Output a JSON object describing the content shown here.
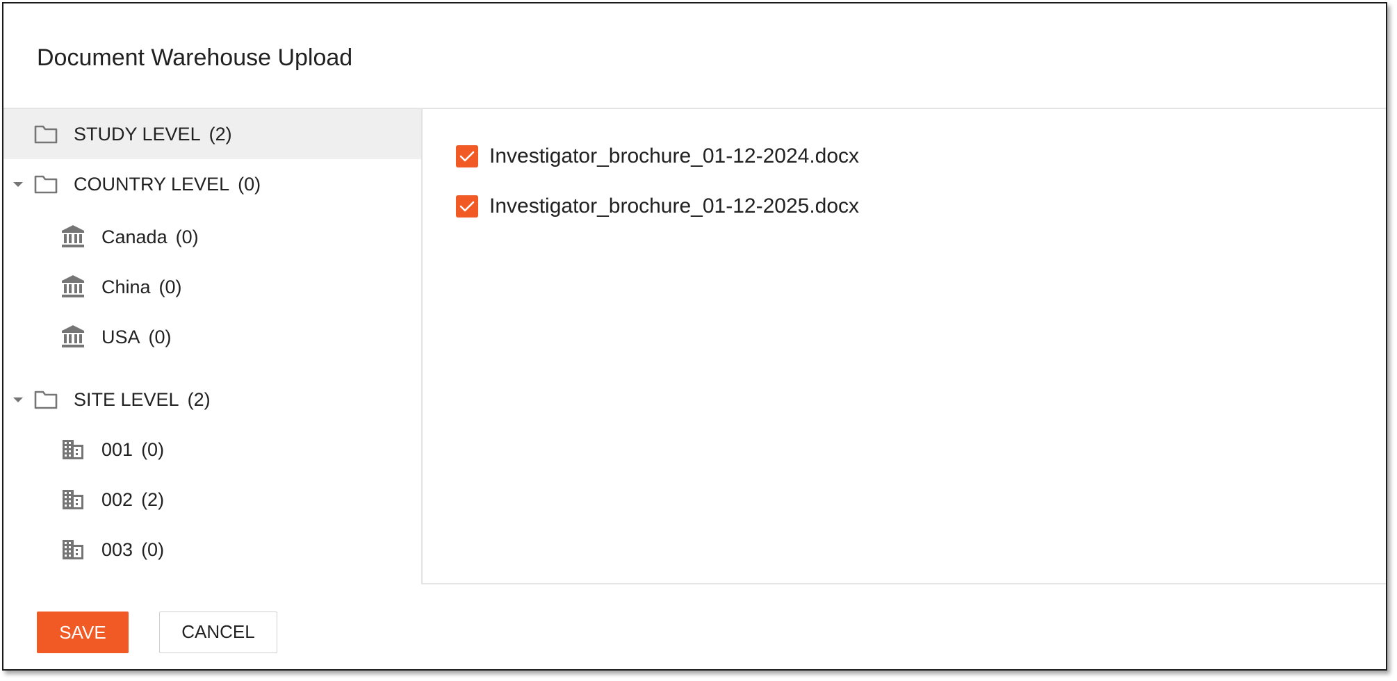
{
  "dialog": {
    "title": "Document Warehouse Upload"
  },
  "tree": {
    "items": [
      {
        "label": "STUDY LEVEL",
        "count": "(2)",
        "icon": "folder-icon",
        "selected": true,
        "expandable": false
      },
      {
        "label": "COUNTRY LEVEL",
        "count": "(0)",
        "icon": "folder-icon",
        "selected": false,
        "expandable": true
      },
      {
        "label": "Canada",
        "count": "(0)",
        "icon": "bank-icon"
      },
      {
        "label": "China",
        "count": "(0)",
        "icon": "bank-icon"
      },
      {
        "label": "USA",
        "count": "(0)",
        "icon": "bank-icon"
      },
      {
        "label": "SITE LEVEL",
        "count": "(2)",
        "icon": "folder-icon",
        "selected": false,
        "expandable": true
      },
      {
        "label": "001",
        "count": "(0)",
        "icon": "building-icon"
      },
      {
        "label": "002",
        "count": "(2)",
        "icon": "building-icon"
      },
      {
        "label": "003",
        "count": "(0)",
        "icon": "building-icon"
      }
    ]
  },
  "files": [
    {
      "name": "Investigator_brochure_01-12-2024.docx",
      "checked": true
    },
    {
      "name": "Investigator_brochure_01-12-2025.docx",
      "checked": true
    }
  ],
  "footer": {
    "save_label": "SAVE",
    "cancel_label": "CANCEL"
  },
  "colors": {
    "accent": "#f15a24",
    "selected_row": "#efefef",
    "icon_gray": "#757575"
  }
}
